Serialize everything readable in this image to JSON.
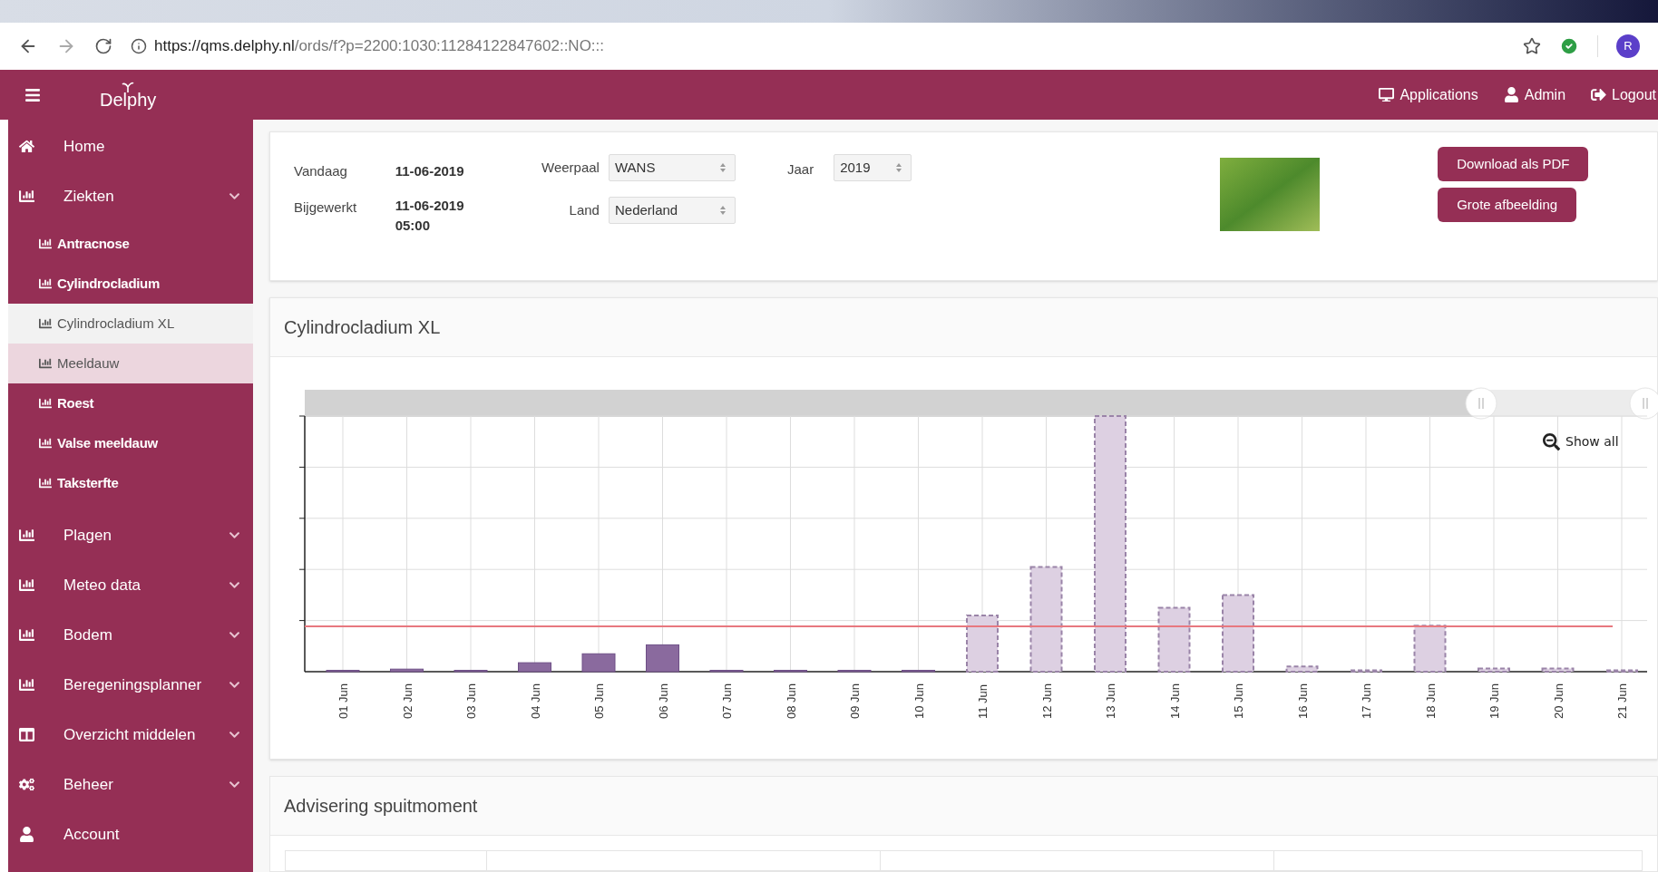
{
  "browser": {
    "url_host": "https://qms.delphy.nl",
    "url_path": "/ords/f?p=2200:1030:11284122847602::NO:::",
    "profile_initial": "R"
  },
  "header": {
    "logo": "Delphy",
    "links": [
      {
        "label": "Applications",
        "kind": "desktop"
      },
      {
        "label": "Admin",
        "kind": "user"
      },
      {
        "label": "Logout",
        "kind": "signout"
      }
    ]
  },
  "sidebar": {
    "items": [
      {
        "label": "Home",
        "kind": "home",
        "expandable": false
      },
      {
        "label": "Ziekten",
        "kind": "chart",
        "expandable": true,
        "children": [
          {
            "label": "Antracnose",
            "selected": false,
            "hovered": false
          },
          {
            "label": "Cylindrocladium",
            "selected": false,
            "hovered": false
          },
          {
            "label": "Cylindrocladium XL",
            "selected": true,
            "hovered": false
          },
          {
            "label": "Meeldauw",
            "selected": false,
            "hovered": true
          },
          {
            "label": "Roest",
            "selected": false,
            "hovered": false
          },
          {
            "label": "Valse meeldauw",
            "selected": false,
            "hovered": false
          },
          {
            "label": "Taksterfte",
            "selected": false,
            "hovered": false
          }
        ]
      },
      {
        "label": "Plagen",
        "kind": "chart",
        "expandable": true
      },
      {
        "label": "Meteo data",
        "kind": "chart",
        "expandable": true
      },
      {
        "label": "Bodem",
        "kind": "chart",
        "expandable": true
      },
      {
        "label": "Beregeningsplanner",
        "kind": "chart",
        "expandable": true
      },
      {
        "label": "Overzicht middelen",
        "kind": "columns",
        "expandable": true
      },
      {
        "label": "Beheer",
        "kind": "cogs",
        "expandable": true
      },
      {
        "label": "Account",
        "kind": "user",
        "expandable": false
      }
    ]
  },
  "info": {
    "today_label": "Vandaag",
    "today": "11-06-2019",
    "updated_label": "Bijgewerkt",
    "updated_date": "11-06-2019",
    "updated_time": "05:00",
    "station_label": "Weerpaal",
    "station": "WANS",
    "country_label": "Land",
    "country": "Nederland",
    "year_label": "Jaar",
    "year": "2019",
    "buttons": [
      "Download als PDF",
      "Grote afbeelding"
    ]
  },
  "chart_panel": {
    "title": "Cylindrocladium XL",
    "show_all": "Show all",
    "days": [
      {
        "label": "01 Jun",
        "kind": "observed"
      },
      {
        "label": "02 Jun",
        "kind": "observed"
      },
      {
        "label": "03 Jun",
        "kind": "observed"
      },
      {
        "label": "04 Jun",
        "kind": "observed"
      },
      {
        "label": "05 Jun",
        "kind": "observed"
      },
      {
        "label": "06 Jun",
        "kind": "observed"
      },
      {
        "label": "07 Jun",
        "kind": "observed"
      },
      {
        "label": "08 Jun",
        "kind": "observed"
      },
      {
        "label": "09 Jun",
        "kind": "observed"
      },
      {
        "label": "10 Jun",
        "kind": "observed"
      },
      {
        "label": "11 Jun",
        "kind": "forecast"
      },
      {
        "label": "12 Jun",
        "kind": "forecast"
      },
      {
        "label": "13 Jun",
        "kind": "forecast"
      },
      {
        "label": "14 Jun",
        "kind": "forecast"
      },
      {
        "label": "15 Jun",
        "kind": "forecast"
      },
      {
        "label": "16 Jun",
        "kind": "forecast"
      },
      {
        "label": "17 Jun",
        "kind": "forecast"
      },
      {
        "label": "18 Jun",
        "kind": "forecast"
      },
      {
        "label": "19 Jun",
        "kind": "forecast"
      },
      {
        "label": "20 Jun",
        "kind": "forecast"
      },
      {
        "label": "21 Jun",
        "kind": "forecast"
      }
    ]
  },
  "advice_panel": {
    "title": "Advisering spuitmoment"
  }
}
